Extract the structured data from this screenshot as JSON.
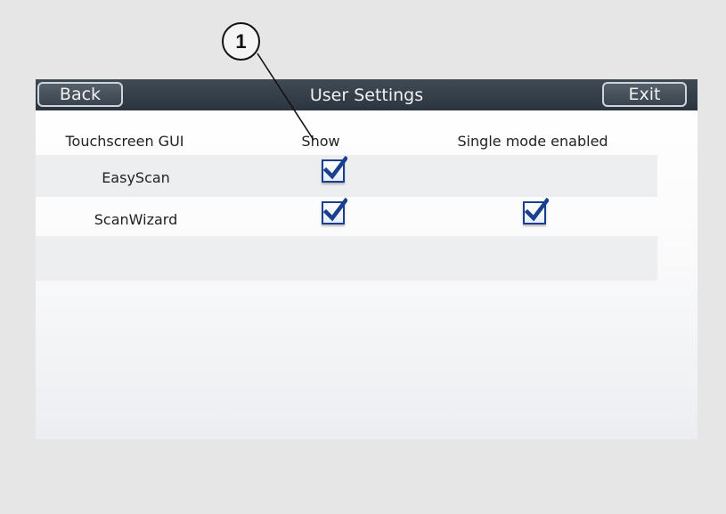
{
  "callout": {
    "number": "1"
  },
  "window": {
    "title": "User Settings",
    "back_label": "Back",
    "exit_label": "Exit"
  },
  "table": {
    "headers": [
      "Touchscreen GUI",
      "Show",
      "Single mode enabled"
    ],
    "rows": [
      {
        "label": "EasyScan",
        "show": true,
        "single_mode": false
      },
      {
        "label": "ScanWizard",
        "show": true,
        "single_mode": true
      }
    ]
  },
  "icons": {
    "checkbox": "checked-checkbox-icon"
  },
  "colors": {
    "title_bar": "#323c47",
    "checkbox_blue": "#1a3f8f",
    "background": "#e6e6e6"
  }
}
